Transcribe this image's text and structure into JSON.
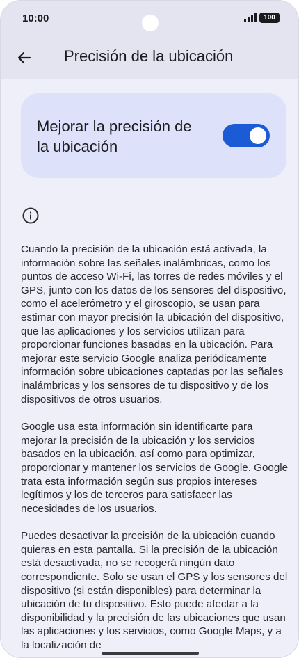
{
  "status_bar": {
    "time": "10:00",
    "battery": "100"
  },
  "app_bar": {
    "title": "Precisión de la ubicación",
    "back_icon": "arrow-left-icon"
  },
  "setting": {
    "label": "Mejorar la precisión de la ubicación",
    "enabled": true,
    "accent_color": "#1b5bd6"
  },
  "info_icon": "info-icon",
  "paragraphs": [
    "Cuando la precisión de la ubicación está activada, la información sobre las señales inalámbricas, como los puntos de acceso Wi-Fi, las torres de redes móviles y el GPS, junto con los datos de los sensores del dispositivo, como el acelerómetro y el giroscopio, se usan para estimar con mayor precisión la ubicación del dispositivo, que las aplicaciones y los servicios utilizan para proporcionar funciones basadas en la ubicación. Para mejorar este servicio Google analiza periódicamente información sobre ubicaciones captadas por las señales inalámbricas y los sensores de tu dispositivo y de los dispositivos de otros usuarios.",
    "Google usa esta información sin identificarte para mejorar la precisión de la ubicación y los servicios basados en la ubicación, así como para optimizar, proporcionar y mantener los servicios de Google. Google trata esta información según sus propios intereses legítimos y los de terceros para satisfacer las necesidades de los usuarios.",
    "Puedes desactivar la precisión de la ubicación cuando quieras en esta pantalla. Si la precisión de la ubicación está desactivada, no se recogerá ningún dato correspondiente. Solo se usan el GPS y los sensores del dispositivo (si están disponibles) para determinar la ubicación de tu dispositivo. Esto puede afectar a la disponibilidad y la precisión de las ubicaciones que usan las aplicaciones y los servicios, como Google Maps, y a la localización de"
  ]
}
